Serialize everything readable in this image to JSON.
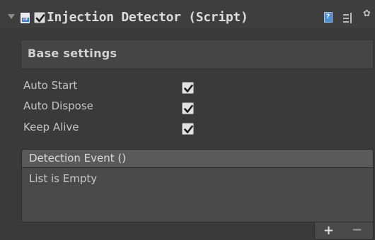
{
  "component": {
    "title": "Injection Detector (Script)",
    "enabled": true,
    "icons": [
      "fold-arrow-icon",
      "script-icon",
      "help-icon",
      "preset-icon",
      "gear-icon"
    ]
  },
  "base_settings": {
    "header": "Base settings",
    "properties": [
      {
        "label": "Auto Start",
        "checked": true
      },
      {
        "label": "Auto Dispose",
        "checked": true
      },
      {
        "label": "Keep Alive",
        "checked": true
      }
    ]
  },
  "event": {
    "title": "Detection Event ()",
    "empty_text": "List is Empty",
    "add_label": "+",
    "remove_label": "−"
  },
  "colors": {
    "background": "#3a3a3a",
    "header_bar": "#5a5a5a",
    "accent": "#4d8fd6"
  }
}
